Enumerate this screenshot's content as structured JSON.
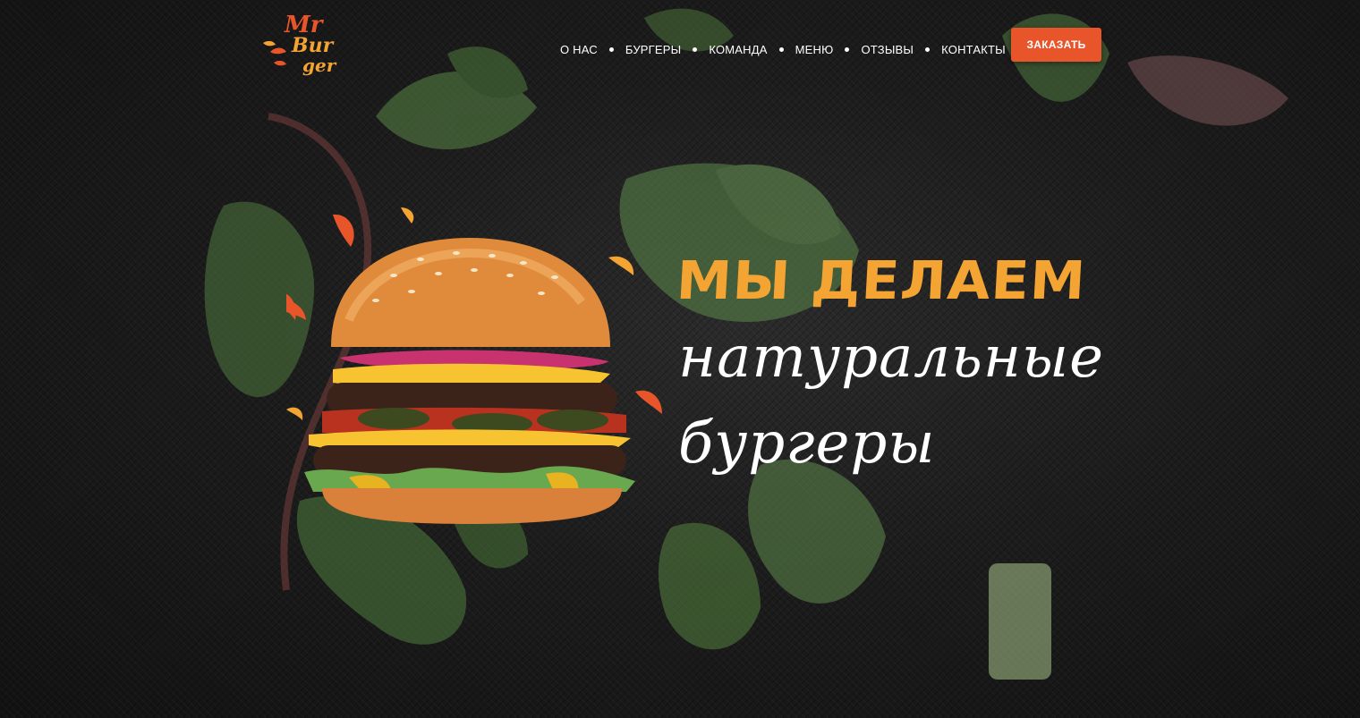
{
  "brand": {
    "logo_text_line1": "Mr",
    "logo_text_line2": "Bur",
    "logo_text_line3": "ger",
    "accent_color": "#e8552a",
    "yellow_color": "#f3a433"
  },
  "nav": {
    "items": [
      {
        "label": "О НАС"
      },
      {
        "label": "БУРГЕРЫ"
      },
      {
        "label": "КОМАНДА"
      },
      {
        "label": "МЕНЮ"
      },
      {
        "label": "ОТЗЫВЫ"
      },
      {
        "label": "КОНТАКТЫ"
      }
    ],
    "order_button": "ЗАКАЗАТЬ"
  },
  "hero": {
    "line1": "МЫ ДЕЛАЕМ",
    "line2": "натуральные",
    "line3": "бургеры"
  }
}
